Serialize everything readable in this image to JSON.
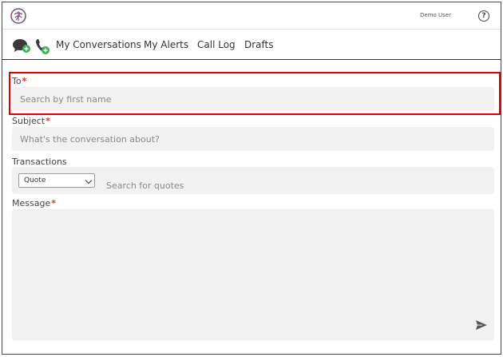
{
  "header": {
    "user_name": "Demo User",
    "help_glyph": "?"
  },
  "nav": {
    "links": [
      "My Conversations",
      "My Alerts",
      "Call Log",
      "Drafts"
    ],
    "icons": [
      "chat-add-icon",
      "phone-add-icon"
    ]
  },
  "form": {
    "to_label": "To",
    "to_placeholder": "Search by first name",
    "subject_label": "Subject",
    "subject_placeholder": "What's the conversation about?",
    "transactions_label": "Transactions",
    "transaction_type": "Quote",
    "transaction_placeholder": "Search for quotes",
    "message_label": "Message",
    "required_mark": "*"
  },
  "colors": {
    "accent_green": "#3cb15a",
    "required_red": "#e0312c",
    "highlight_red": "#e00000",
    "field_bg": "#f1f1f1"
  }
}
